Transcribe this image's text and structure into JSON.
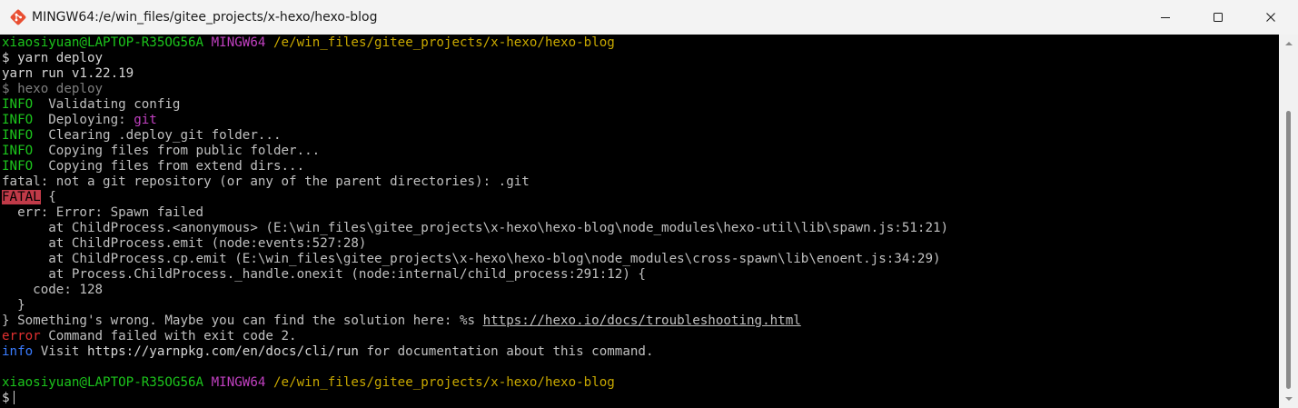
{
  "window": {
    "title": "MINGW64:/e/win_files/gitee_projects/x-hexo/hexo-blog",
    "app_icon": "git-bash-icon",
    "controls": [
      "minimize-icon",
      "maximize-icon",
      "close-icon"
    ]
  },
  "terminal": {
    "colors": {
      "background": "#000000",
      "default": "#c0c0c0",
      "user_host": "#1cc51c",
      "shell": "#c040c0",
      "path": "#c8a800",
      "dim": "#7f7f7f",
      "fatal_bg": "#c03a48",
      "error": "#e03030",
      "info": "#3a7cff"
    },
    "lines": [
      {
        "segments": [
          {
            "text": "xiaosiyuan@LAPTOP-R35OG56A",
            "cls": "c-green"
          },
          {
            "text": " "
          },
          {
            "text": "MINGW64",
            "cls": "c-purple"
          },
          {
            "text": " "
          },
          {
            "text": "/e/win_files/gitee_projects/x-hexo/hexo-blog",
            "cls": "c-yellow"
          }
        ]
      },
      {
        "segments": [
          {
            "text": "$ yarn deploy",
            "cls": "c-white"
          }
        ]
      },
      {
        "segments": [
          {
            "text": "yarn run v1.22.19",
            "cls": "c-white"
          }
        ]
      },
      {
        "segments": [
          {
            "text": "$ hexo deploy",
            "cls": "c-gray"
          }
        ]
      },
      {
        "segments": [
          {
            "text": "INFO",
            "cls": "c-green"
          },
          {
            "text": "  Validating config"
          }
        ]
      },
      {
        "segments": [
          {
            "text": "INFO",
            "cls": "c-green"
          },
          {
            "text": "  Deploying: "
          },
          {
            "text": "git",
            "cls": "c-purple"
          }
        ]
      },
      {
        "segments": [
          {
            "text": "INFO",
            "cls": "c-green"
          },
          {
            "text": "  Clearing .deploy_git folder..."
          }
        ]
      },
      {
        "segments": [
          {
            "text": "INFO",
            "cls": "c-green"
          },
          {
            "text": "  Copying files from public folder..."
          }
        ]
      },
      {
        "segments": [
          {
            "text": "INFO",
            "cls": "c-green"
          },
          {
            "text": "  Copying files from extend dirs..."
          }
        ]
      },
      {
        "segments": [
          {
            "text": "fatal: not a git repository (or any of the parent directories): .git"
          }
        ]
      },
      {
        "segments": [
          {
            "text": "FATAL",
            "cls": "c-fatal"
          },
          {
            "text": " {"
          }
        ]
      },
      {
        "segments": [
          {
            "text": "  err: Error: Spawn failed"
          }
        ]
      },
      {
        "segments": [
          {
            "text": "      at ChildProcess.<anonymous> (E:\\win_files\\gitee_projects\\x-hexo\\hexo-blog\\node_modules\\hexo-util\\lib\\spawn.js:51:21)"
          }
        ]
      },
      {
        "segments": [
          {
            "text": "      at ChildProcess.emit (node:events:527:28)"
          }
        ]
      },
      {
        "segments": [
          {
            "text": "      at ChildProcess.cp.emit (E:\\win_files\\gitee_projects\\x-hexo\\hexo-blog\\node_modules\\cross-spawn\\lib\\enoent.js:34:29)"
          }
        ]
      },
      {
        "segments": [
          {
            "text": "      at Process.ChildProcess._handle.onexit (node:internal/child_process:291:12) {"
          }
        ]
      },
      {
        "segments": [
          {
            "text": "    code: 128"
          }
        ]
      },
      {
        "segments": [
          {
            "text": "  }"
          }
        ]
      },
      {
        "segments": [
          {
            "text": "} Something's wrong. Maybe you can find the solution here: %s "
          },
          {
            "text": "https://hexo.io/docs/troubleshooting.html",
            "cls": "u",
            "link": true
          }
        ]
      },
      {
        "segments": [
          {
            "text": "error",
            "cls": "c-red"
          },
          {
            "text": " Command failed with exit code 2."
          }
        ]
      },
      {
        "segments": [
          {
            "text": "info",
            "cls": "c-blue"
          },
          {
            "text": " Visit "
          },
          {
            "text": "https://yarnpkg.com/en/docs/cli/run",
            "cls": "c-white"
          },
          {
            "text": " for documentation about this command."
          }
        ]
      },
      {
        "segments": []
      },
      {
        "segments": [
          {
            "text": "xiaosiyuan@LAPTOP-R35OG56A",
            "cls": "c-green"
          },
          {
            "text": " "
          },
          {
            "text": "MINGW64",
            "cls": "c-purple"
          },
          {
            "text": " "
          },
          {
            "text": "/e/win_files/gitee_projects/x-hexo/hexo-blog",
            "cls": "c-yellow"
          }
        ]
      },
      {
        "segments": [
          {
            "text": "$",
            "cls": "c-white"
          }
        ],
        "cursor": true
      }
    ]
  },
  "scrollbar": {
    "icons": [
      "scroll-up-arrow-icon",
      "scroll-down-arrow-icon"
    ]
  }
}
